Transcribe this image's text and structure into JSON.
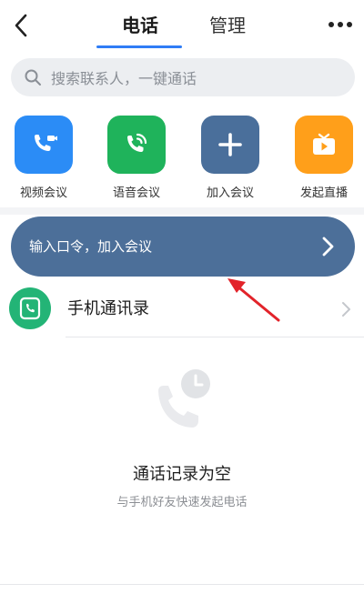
{
  "header": {
    "tabs": [
      {
        "label": "电话",
        "active": true
      },
      {
        "label": "管理",
        "active": false
      }
    ],
    "back_icon": "chevron-left-icon",
    "more_icon": "more-horizontal-icon"
  },
  "search": {
    "placeholder": "搜索联系人，一键通话",
    "icon": "search-icon"
  },
  "actions": [
    {
      "label": "视频会议",
      "icon": "video-call-icon",
      "color": "#2b8cf6"
    },
    {
      "label": "语音会议",
      "icon": "voice-call-icon",
      "color": "#1fb35b"
    },
    {
      "label": "加入会议",
      "icon": "plus-icon",
      "color": "#4a6f9b"
    },
    {
      "label": "发起直播",
      "icon": "live-tv-icon",
      "color": "#ff9f1a"
    }
  ],
  "code_banner": {
    "label": "输入口令，加入会议",
    "color": "#4c6f99"
  },
  "contacts": {
    "label": "手机通讯录",
    "icon": "phone-book-icon",
    "color": "#23b476"
  },
  "empty_state": {
    "title": "通话记录为空",
    "subtitle": "与手机好友快速发起电话",
    "icon": "call-history-icon"
  },
  "colors": {
    "accent": "#2f7df6",
    "annotation": "#e2232a"
  }
}
